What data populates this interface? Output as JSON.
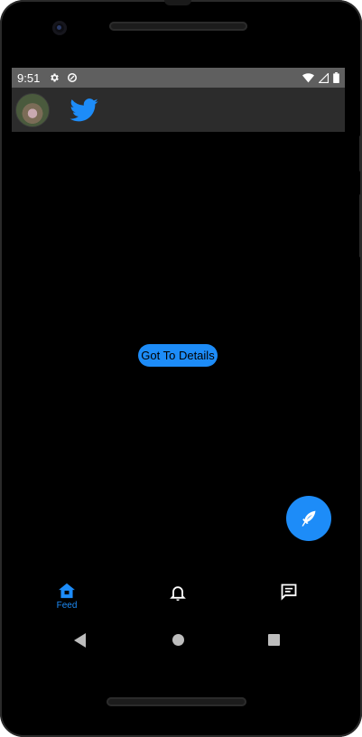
{
  "status_bar": {
    "time": "9:51",
    "icons_left": [
      "gear-icon",
      "data-saver-icon"
    ],
    "icons_right": [
      "wifi-icon",
      "signal-icon",
      "battery-icon"
    ]
  },
  "app_bar": {
    "avatar": "profile-avatar",
    "logo": "twitter-bird-icon"
  },
  "main": {
    "details_button_label": "Got To Details"
  },
  "fab": {
    "icon": "feather-quill-icon"
  },
  "bottom_nav": {
    "items": [
      {
        "label": "Feed",
        "icon": "home-icon",
        "active": true
      },
      {
        "label": "",
        "icon": "bell-icon",
        "active": false
      },
      {
        "label": "",
        "icon": "message-icon",
        "active": false
      }
    ]
  },
  "system_nav": [
    "back-icon",
    "home-circle-icon",
    "recents-square-icon"
  ],
  "colors": {
    "accent": "#1d8cf8",
    "status_bar": "#5f5f5f",
    "app_bar": "#2c2c2c",
    "background": "#000000"
  }
}
